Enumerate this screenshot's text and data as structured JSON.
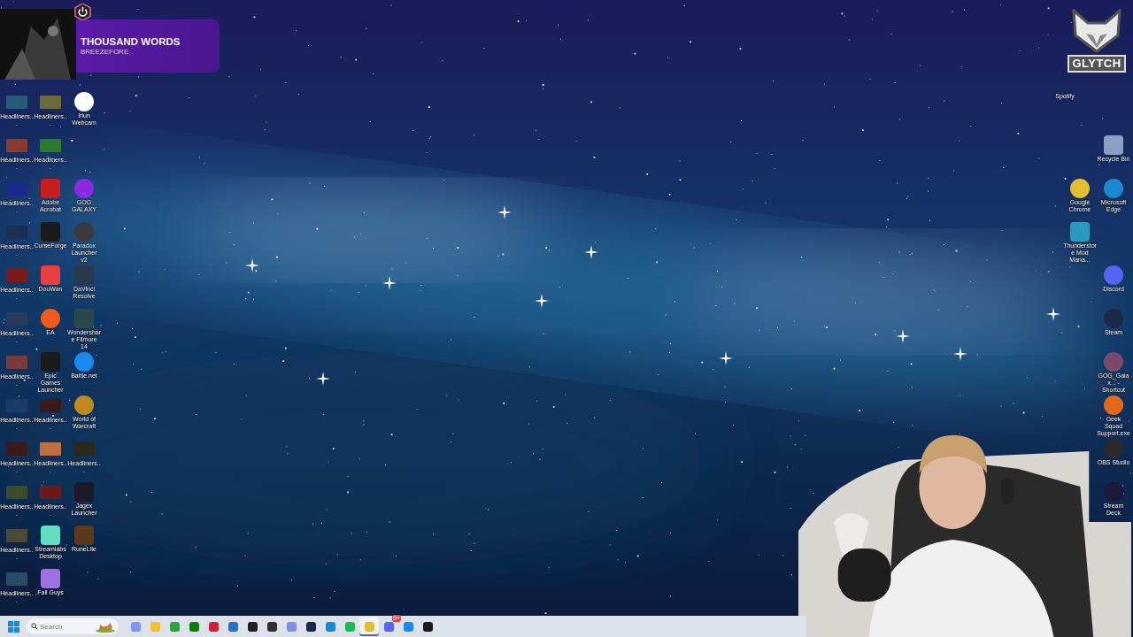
{
  "now_playing": {
    "title": "THOUSAND WORDS",
    "artist": "BREEZEFORE"
  },
  "logo": {
    "text": "GLYTCH"
  },
  "top_right_label": "Spotify",
  "left_columns": [
    [
      {
        "kind": "thumbnail",
        "label": "Headliners...",
        "color": "#2a5a7a"
      },
      {
        "kind": "thumbnail",
        "label": "Headliners...",
        "color": "#8a3a30"
      },
      {
        "kind": "thumbnail",
        "label": "Headliners...",
        "color": "#1a2a8a"
      },
      {
        "kind": "thumbnail",
        "label": "Headliners...",
        "color": "#1a3050"
      },
      {
        "kind": "thumbnail",
        "label": "Headliners...",
        "color": "#7a1a1a"
      },
      {
        "kind": "thumbnail",
        "label": "Headliners...",
        "color": "#2a3a5a"
      },
      {
        "kind": "thumbnail",
        "label": "Headliners...",
        "color": "#7a3a3a"
      },
      {
        "kind": "thumbnail",
        "label": "Headliners...",
        "color": "#1a3a6a"
      },
      {
        "kind": "thumbnail",
        "label": "Headliners...",
        "color": "#3a1a1a"
      },
      {
        "kind": "thumbnail",
        "label": "Headliners...",
        "color": "#3a4a2a"
      },
      {
        "kind": "thumbnail",
        "label": "Headliners...",
        "color": "#4a4a3a"
      },
      {
        "kind": "thumbnail",
        "label": "Headliners...",
        "color": "#2a4a6a"
      }
    ],
    [
      {
        "kind": "thumbnail",
        "label": "Headliners...",
        "color": "#6a6a3a"
      },
      {
        "kind": "thumbnail",
        "label": "Headliners...",
        "color": "#2a7a2a"
      },
      {
        "kind": "app",
        "label": "Adobe Acrobat",
        "color": "#c81e1e"
      },
      {
        "kind": "app",
        "label": "CurseForge",
        "color": "#1a1a1a"
      },
      {
        "kind": "app",
        "label": "DouWan",
        "color": "#e84040"
      },
      {
        "kind": "round",
        "label": "EA",
        "color": "#f05a1a"
      },
      {
        "kind": "app",
        "label": "Epic Games Launcher",
        "color": "#1a1a1a"
      },
      {
        "kind": "thumbnail",
        "label": "Headliners...",
        "color": "#3a1a1a"
      },
      {
        "kind": "thumbnail",
        "label": "Headliners...",
        "color": "#c07040"
      },
      {
        "kind": "thumbnail",
        "label": "Headliners...",
        "color": "#6a1a1a"
      },
      {
        "kind": "app",
        "label": "Streamlabs Desktop",
        "color": "#60e0c0"
      },
      {
        "kind": "app",
        "label": "Fall Guys",
        "color": "#a070e0"
      }
    ],
    [
      {
        "kind": "round",
        "label": "Iriun Webcam",
        "color": "#ffffff"
      },
      {
        "kind": "empty"
      },
      {
        "kind": "round",
        "label": "GOG GALAXY",
        "color": "#8a2be2"
      },
      {
        "kind": "round",
        "label": "Paradox Launcher v2",
        "color": "#3a3a3a"
      },
      {
        "kind": "app",
        "label": "DaVinci Resolve",
        "color": "#2a3a4a"
      },
      {
        "kind": "app",
        "label": "Wondershare Filmore 14",
        "color": "#2a4a4a"
      },
      {
        "kind": "round",
        "label": "Battle.net",
        "color": "#1a8af0"
      },
      {
        "kind": "round",
        "label": "World of Warcraft",
        "color": "#c08a20"
      },
      {
        "kind": "thumbnail",
        "label": "Headliners...",
        "color": "#2a2a1a"
      },
      {
        "kind": "app",
        "label": "Jagex Launcher",
        "color": "#1a1a2a"
      },
      {
        "kind": "app",
        "label": "RuneLite",
        "color": "#5a3a1a"
      }
    ]
  ],
  "right_columns": [
    [
      {
        "kind": "empty"
      },
      {
        "kind": "round",
        "label": "Google Chrome",
        "color": "#e0c030"
      },
      {
        "kind": "app",
        "label": "Thunderstore Mod Mana...",
        "color": "#2a9ac0"
      }
    ],
    [
      {
        "kind": "app",
        "label": "Recycle Bin",
        "color": "#8aa0c0"
      },
      {
        "kind": "round",
        "label": "Microsoft Edge",
        "color": "#1a8ad0"
      },
      {
        "kind": "empty"
      },
      {
        "kind": "round",
        "label": "Discord",
        "color": "#5865f2"
      },
      {
        "kind": "round",
        "label": "Steam",
        "color": "#1a2a4a"
      },
      {
        "kind": "round",
        "label": "GOG_Galax... - Shortcut",
        "color": "#7a4a6a"
      },
      {
        "kind": "round",
        "label": "Geek Squad Support.exe",
        "color": "#e06a1a"
      },
      {
        "kind": "round",
        "label": "OBS Studio",
        "color": "#2a2a2a"
      },
      {
        "kind": "round",
        "label": "Stream Deck",
        "color": "#1a1a3a"
      }
    ]
  ],
  "taskbar": {
    "search": {
      "placeholder": "Search"
    },
    "apps": [
      {
        "color": "#7a9af0",
        "selected": false
      },
      {
        "color": "#f0c030",
        "selected": false
      },
      {
        "color": "#30a040",
        "selected": false
      },
      {
        "color": "#107c10",
        "selected": false
      },
      {
        "color": "#d0203a",
        "selected": false
      },
      {
        "color": "#2a70c0",
        "selected": false
      },
      {
        "color": "#202020",
        "selected": false
      },
      {
        "color": "#303030",
        "selected": false
      },
      {
        "color": "#8090e0",
        "selected": false
      },
      {
        "color": "#1a2a4a",
        "selected": false
      },
      {
        "color": "#1a8ad0",
        "selected": false
      },
      {
        "color": "#1db954",
        "selected": false
      },
      {
        "color": "#e0c030",
        "selected": true
      },
      {
        "color": "#5865f2",
        "selected": false,
        "badge": "9+"
      },
      {
        "color": "#1a8af0",
        "selected": false
      },
      {
        "color": "#1a1a1a",
        "selected": false
      }
    ]
  }
}
